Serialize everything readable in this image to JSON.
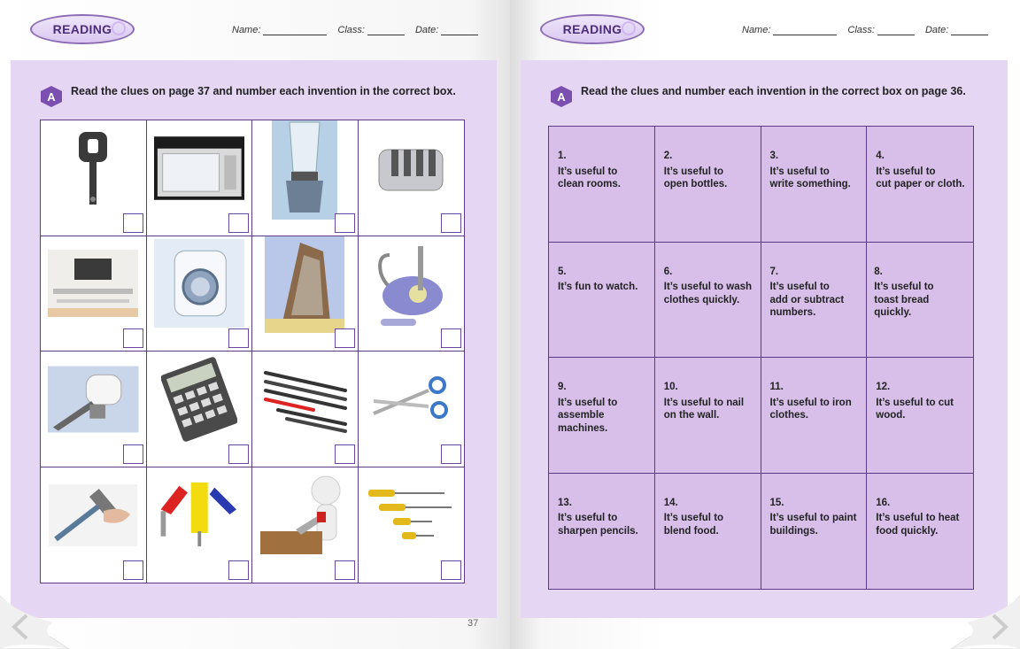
{
  "header": {
    "badge": "READING",
    "name_label": "Name:",
    "class_label": "Class:",
    "date_label": "Date:"
  },
  "left_page": {
    "section_letter": "A",
    "instruction": "Read the clues on page 37 and number each invention in the correct box.",
    "page_number": "37",
    "items": [
      "bottle-opener",
      "microwave",
      "blender",
      "toaster",
      "television",
      "washing-machine",
      "iron",
      "vacuum-cleaner",
      "pencil-sharpener",
      "calculator",
      "pens",
      "scissors",
      "hammer",
      "paint-rollers",
      "saw",
      "screwdrivers"
    ]
  },
  "right_page": {
    "section_letter": "A",
    "instruction": "Read the clues and number each invention in the correct box on page 36.",
    "clues": [
      {
        "num": "1.",
        "text": "It’s useful to\nclean  rooms."
      },
      {
        "num": "2.",
        "text": "It’s useful to\nopen bottles."
      },
      {
        "num": "3.",
        "text": "It’s useful to\nwrite something."
      },
      {
        "num": "4.",
        "text": "It’s useful to\ncut paper or cloth."
      },
      {
        "num": "5.",
        "text": "It’s fun to watch."
      },
      {
        "num": "6.",
        "text": "It’s useful to wash\nclothes quickly."
      },
      {
        "num": "7.",
        "text": "It’s useful to\nadd or subtract\nnumbers."
      },
      {
        "num": "8.",
        "text": "It’s useful to\ntoast bread quickly."
      },
      {
        "num": "9.",
        "text": "It’s useful to\nassemble\nmachines."
      },
      {
        "num": "10.",
        "text": "It’s useful to nail\non the wall."
      },
      {
        "num": "11.",
        "text": "It’s useful to iron\nclothes."
      },
      {
        "num": "12.",
        "text": "It’s useful to cut\nwood."
      },
      {
        "num": "13.",
        "text": "It’s useful to\nsharpen pencils."
      },
      {
        "num": "14.",
        "text": "It’s useful to\nblend food."
      },
      {
        "num": "15.",
        "text": "It’s useful to paint\nbuildings."
      },
      {
        "num": "16.",
        "text": "It’s useful to heat\nfood quickly."
      }
    ]
  },
  "colors": {
    "panel": "#e5d6f3",
    "clue_bg": "#d8bfea",
    "border": "#5a3b84",
    "accent": "#7a4fb0"
  }
}
